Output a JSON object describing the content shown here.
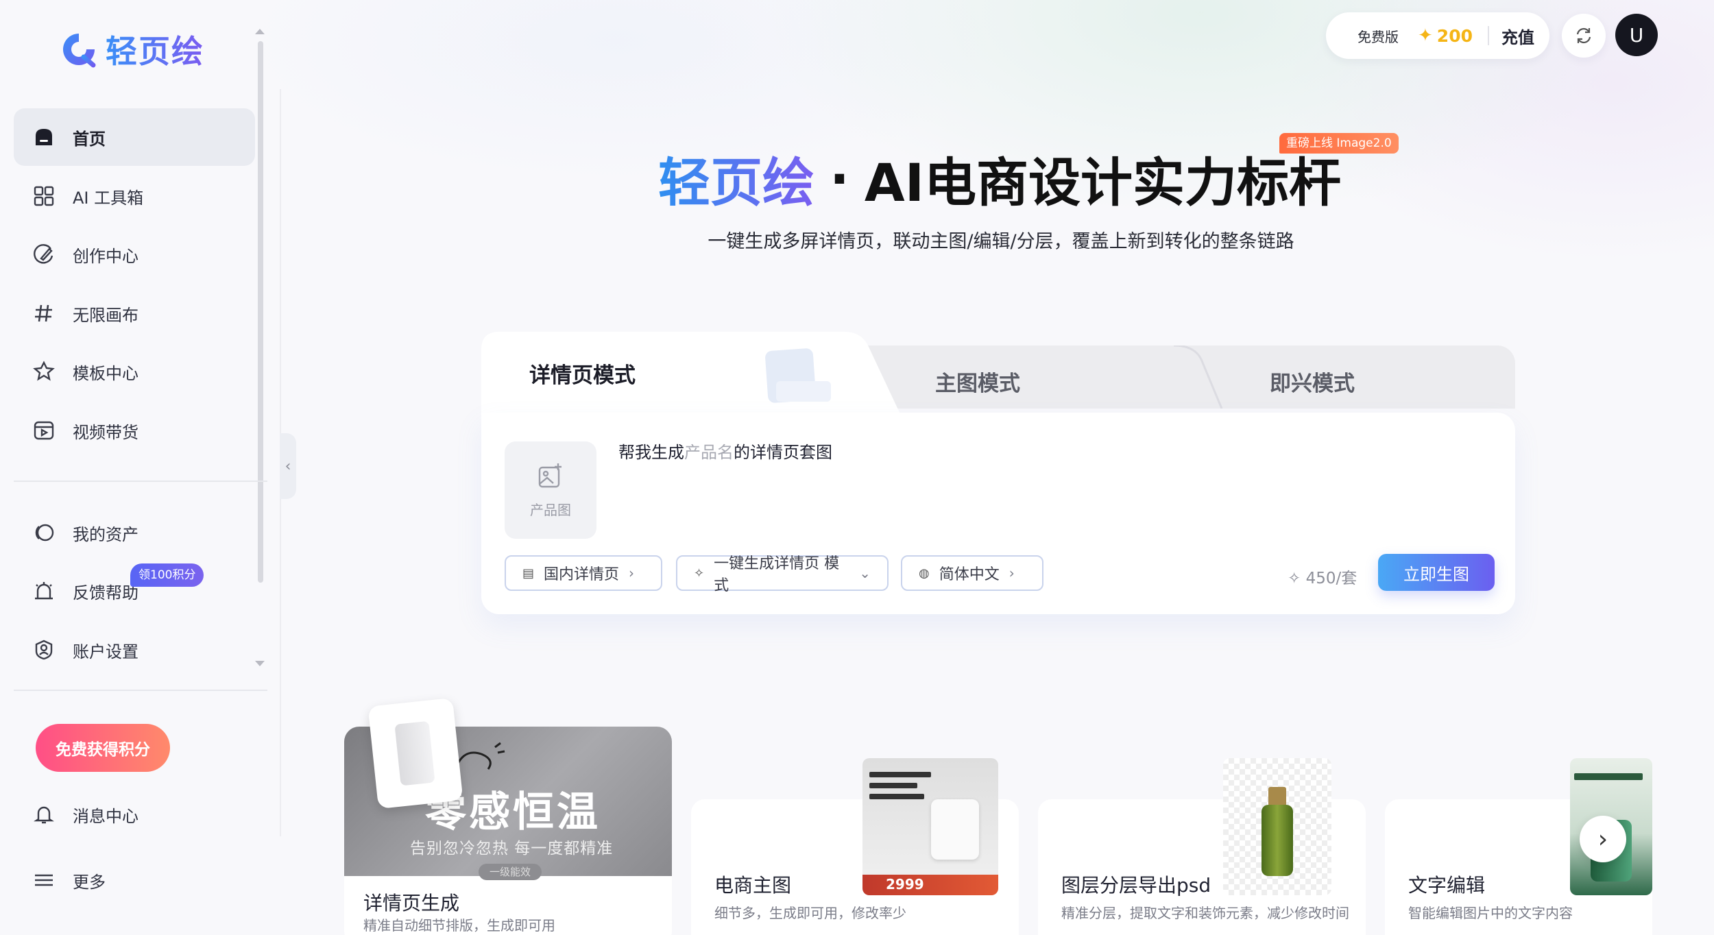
{
  "brand": {
    "name": "轻页绘"
  },
  "sidebar": {
    "items": [
      {
        "label": "首页",
        "icon": "home-icon"
      },
      {
        "label": "AI 工具箱",
        "icon": "grid-icon"
      },
      {
        "label": "创作中心",
        "icon": "palette-icon"
      },
      {
        "label": "无限画布",
        "icon": "hash-icon"
      },
      {
        "label": "模板中心",
        "icon": "template-icon"
      },
      {
        "label": "视频带货",
        "icon": "video-icon"
      },
      {
        "label": "我的资产",
        "icon": "assets-icon"
      },
      {
        "label": "反馈帮助",
        "icon": "alarm-icon"
      },
      {
        "label": "账户设置",
        "icon": "account-icon"
      },
      {
        "label": "消息中心",
        "icon": "bell-icon"
      },
      {
        "label": "更多",
        "icon": "menu-icon"
      }
    ],
    "feedback_badge": "领100积分",
    "free_points_button": "免费获得积分"
  },
  "header": {
    "plan": "免费版",
    "points": "200",
    "recharge": "充值",
    "avatar_initial": "U"
  },
  "hero": {
    "brand": "轻页绘",
    "dot": "·",
    "title": "AI电商设计实力标杆",
    "badge": "重磅上线 Image2.0",
    "subtitle": "一键生成多屏详情页，联动主图/编辑/分层，覆盖上新到转化的整条链路"
  },
  "modes": {
    "tabs": [
      "详情页模式",
      "主图模式",
      "即兴模式"
    ],
    "active": 0
  },
  "composer": {
    "product_slot_label": "产品图",
    "prompt_prefix": "帮我生成",
    "prompt_placeholder": "产品名",
    "prompt_suffix": "的详情页套图",
    "options": [
      "国内详情页",
      "一键生成详情页 模式",
      "简体中文"
    ],
    "cost": "450/套",
    "generate_button": "立即生图"
  },
  "features": [
    {
      "title": "详情页生成",
      "desc": "精准自动细节排版，生成即可用",
      "image_text": "零感恒温",
      "image_sub": "告别忽冷忽热 每一度都精准",
      "image_tag": "一级能效"
    },
    {
      "title": "电商主图",
      "desc": "细节多，生成即可用，修改率少",
      "thumb_price": "2999"
    },
    {
      "title": "图层分层导出psd",
      "desc": "精准分层，提取文字和装饰元素，减少修改时间"
    },
    {
      "title": "文字编辑",
      "desc": "智能编辑图片中的文字内容"
    }
  ],
  "colors": {
    "accent": "#5b6cf3",
    "brand_gradient_start": "#3a8ff7",
    "brand_gradient_end": "#7b5cf0",
    "points": "#f5b516"
  }
}
